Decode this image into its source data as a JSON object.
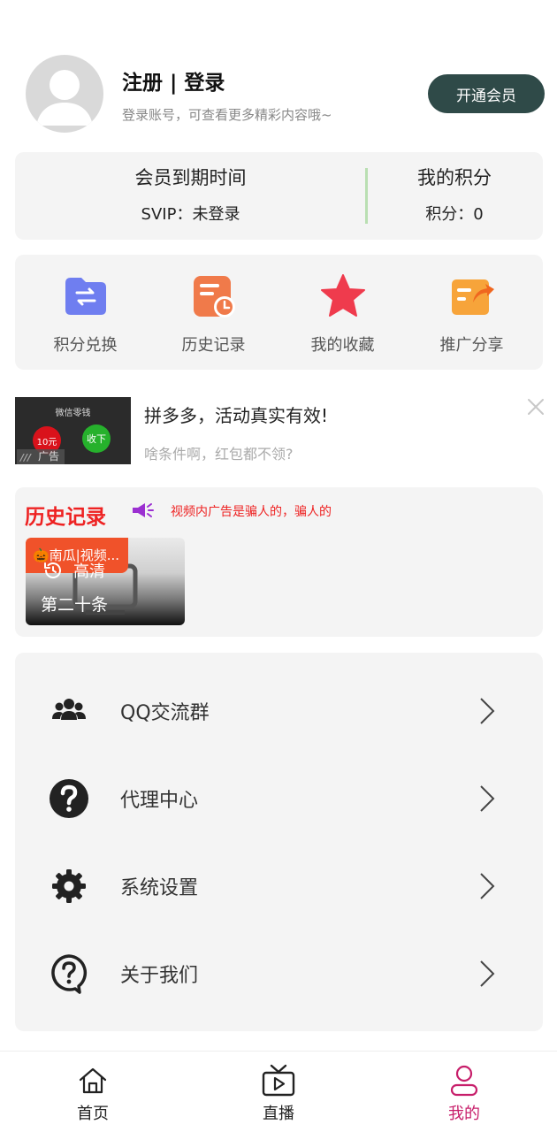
{
  "profile": {
    "title": "注册 | 登录",
    "subtitle": "登录账号，可查看更多精彩内容哦~",
    "vip_button": "开通会员"
  },
  "stats": {
    "membership_label": "会员到期时间",
    "membership_value": "SVIP：未登录",
    "points_label": "我的积分",
    "points_value": "积分：0"
  },
  "actions": [
    {
      "label": "积分兑换",
      "icon": "exchange-folder-icon",
      "color": "#6f7ef0"
    },
    {
      "label": "历史记录",
      "icon": "history-clock-icon",
      "color": "#f07a4a"
    },
    {
      "label": "我的收藏",
      "icon": "star-icon",
      "color": "#ef3b4d"
    },
    {
      "label": "推广分享",
      "icon": "share-icon",
      "color": "#f7a43a"
    }
  ],
  "ad": {
    "thumb_top": "微信零钱",
    "thumb_red": "10元",
    "thumb_green": "收下",
    "thumb_tag": "广告",
    "title": "拼多多，活动真实有效!",
    "description": "啥条件啊，红包都不领?"
  },
  "history": {
    "title": "历史记录",
    "notice": "视频内广告是骗人的，骗人的",
    "item": {
      "badge": "🎃南瓜|视频...",
      "quality": "高清",
      "episode": "第二十条"
    }
  },
  "menu": [
    {
      "label": "QQ交流群",
      "icon": "group-icon"
    },
    {
      "label": "代理中心",
      "icon": "question-icon"
    },
    {
      "label": "系统设置",
      "icon": "gear-icon"
    },
    {
      "label": "关于我们",
      "icon": "help-bubble-icon"
    }
  ],
  "nav": [
    {
      "label": "首页",
      "icon": "home-icon"
    },
    {
      "label": "直播",
      "icon": "tv-icon"
    },
    {
      "label": "我的",
      "icon": "user-icon",
      "active": true
    }
  ],
  "colors": {
    "vip_button": "#2f4a48",
    "accent_active": "#c71e6a",
    "history_red": "#ee2222",
    "card_bg": "#f4f4f4"
  }
}
